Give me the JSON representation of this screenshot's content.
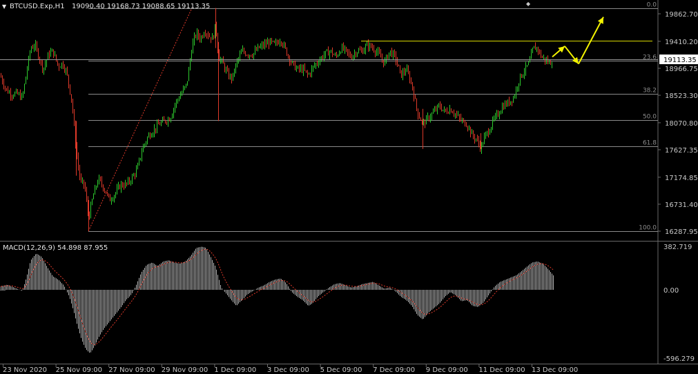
{
  "window": {
    "symbol_title": "BTCUSD.Exp,H1",
    "ohlc_text": "19090.40 19168.73 19088.65 19113.35",
    "dropdown_glyph": "▼"
  },
  "colors": {
    "background": "#000000",
    "bull": "#2ecc2e",
    "bear": "#e03a2a",
    "grid_line": "#8a8a8a",
    "resistance": "#d9d900",
    "arrow": "#f2f200",
    "macd_hist": "#b4b4b4",
    "signal": "#e03a2a",
    "text": "#c8c8c8"
  },
  "chart_data": [
    {
      "type": "candlestick",
      "title": "BTCUSD.Exp,H1",
      "price_axis_labels": [
        "19862.70",
        "19410.20",
        "18966.75",
        "18523.30",
        "18070.80",
        "17627.35",
        "17174.85",
        "16731.40",
        "16287.95"
      ],
      "current_price": "19113.35",
      "ylim": [
        16210,
        20080
      ],
      "x_labels": [
        "23 Nov 2020",
        "25 Nov 09:00",
        "27 Nov 09:00",
        "29 Nov 09:00",
        "1 Dec 09:00",
        "3 Dec 09:00",
        "5 Dec 09:00",
        "7 Dec 09:00",
        "9 Dec 09:00",
        "11 Dec 09:00",
        "13 Dec 09:00"
      ],
      "close_path": [
        [
          0,
          18850
        ],
        [
          8,
          18620
        ],
        [
          16,
          18540
        ],
        [
          24,
          18550
        ],
        [
          32,
          18480
        ],
        [
          38,
          18900
        ],
        [
          44,
          19300
        ],
        [
          50,
          19350
        ],
        [
          56,
          19150
        ],
        [
          62,
          18950
        ],
        [
          70,
          19200
        ],
        [
          76,
          19250
        ],
        [
          84,
          19000
        ],
        [
          90,
          19050
        ],
        [
          96,
          18900
        ],
        [
          104,
          18400
        ],
        [
          110,
          17600
        ],
        [
          116,
          17100
        ],
        [
          122,
          17050
        ],
        [
          128,
          16500
        ],
        [
          134,
          16850
        ],
        [
          142,
          17150
        ],
        [
          150,
          17000
        ],
        [
          158,
          16800
        ],
        [
          166,
          16900
        ],
        [
          174,
          17050
        ],
        [
          182,
          17050
        ],
        [
          190,
          17150
        ],
        [
          198,
          17300
        ],
        [
          206,
          17650
        ],
        [
          214,
          17850
        ],
        [
          222,
          17950
        ],
        [
          230,
          18050
        ],
        [
          238,
          18100
        ],
        [
          246,
          18150
        ],
        [
          254,
          18400
        ],
        [
          262,
          18550
        ],
        [
          270,
          18700
        ],
        [
          278,
          19350
        ],
        [
          284,
          19550
        ],
        [
          290,
          19450
        ],
        [
          296,
          19600
        ],
        [
          302,
          19500
        ],
        [
          308,
          19450
        ],
        [
          312,
          19700
        ],
        [
          316,
          19150
        ],
        [
          322,
          19050
        ],
        [
          330,
          18850
        ],
        [
          336,
          18800
        ],
        [
          342,
          19050
        ],
        [
          350,
          19250
        ],
        [
          358,
          19200
        ],
        [
          366,
          19200
        ],
        [
          374,
          19300
        ],
        [
          382,
          19350
        ],
        [
          390,
          19400
        ],
        [
          398,
          19350
        ],
        [
          406,
          19450
        ],
        [
          414,
          19250
        ],
        [
          422,
          19050
        ],
        [
          430,
          18950
        ],
        [
          438,
          18950
        ],
        [
          446,
          18850
        ],
        [
          454,
          19000
        ],
        [
          462,
          19100
        ],
        [
          470,
          19200
        ],
        [
          478,
          19250
        ],
        [
          486,
          19150
        ],
        [
          494,
          19300
        ],
        [
          500,
          19250
        ],
        [
          508,
          19150
        ],
        [
          516,
          19250
        ],
        [
          524,
          19250
        ],
        [
          532,
          19350
        ],
        [
          540,
          19300
        ],
        [
          548,
          19200
        ],
        [
          556,
          19050
        ],
        [
          564,
          19250
        ],
        [
          572,
          19150
        ],
        [
          580,
          18850
        ],
        [
          588,
          18950
        ],
        [
          596,
          18700
        ],
        [
          604,
          18250
        ],
        [
          612,
          18050
        ],
        [
          620,
          18150
        ],
        [
          628,
          18250
        ],
        [
          636,
          18350
        ],
        [
          644,
          18250
        ],
        [
          652,
          18300
        ],
        [
          660,
          18200
        ],
        [
          668,
          18100
        ],
        [
          676,
          18050
        ],
        [
          684,
          17850
        ],
        [
          690,
          17800
        ],
        [
          696,
          17650
        ],
        [
          702,
          17850
        ],
        [
          708,
          17950
        ],
        [
          714,
          18100
        ],
        [
          720,
          18200
        ],
        [
          728,
          18350
        ],
        [
          736,
          18400
        ],
        [
          744,
          18500
        ],
        [
          752,
          18800
        ],
        [
          760,
          18950
        ],
        [
          766,
          19050
        ],
        [
          772,
          19300
        ],
        [
          778,
          19300
        ],
        [
          784,
          19150
        ],
        [
          790,
          19100
        ],
        [
          796,
          19050
        ],
        [
          800,
          19110
        ]
      ],
      "fibonacci": {
        "levels": [
          {
            "label": "0.0",
            "price": 19958
          },
          {
            "label": "23.6",
            "price": 19090
          },
          {
            "label": "38.2",
            "price": 18550
          },
          {
            "label": "50.0",
            "price": 18118
          },
          {
            "label": "61.8",
            "price": 17685
          },
          {
            "label": "100.0",
            "price": 16287
          }
        ],
        "swing_from": {
          "bar_x": 128,
          "price": 16287
        },
        "swing_to": {
          "bar_x": 278,
          "price": 19958
        }
      },
      "resistance_line": {
        "price": 19420,
        "from_x": 523,
        "to_x": 945
      },
      "forecast_arrows": [
        {
          "from": [
            800,
            19155
          ],
          "to": [
            818,
            19330
          ]
        },
        {
          "from": [
            818,
            19330
          ],
          "to": [
            838,
            19040
          ]
        },
        {
          "from": [
            838,
            19040
          ],
          "to": [
            874,
            19810
          ]
        }
      ]
    },
    {
      "type": "histogram",
      "title": "MACD(12,26,9) 54.898 87.955",
      "axis_labels": [
        "382.719",
        "0.00",
        "-596.279"
      ],
      "ylim": [
        -596.279,
        382.719
      ],
      "macd_path": [
        [
          0,
          30
        ],
        [
          10,
          45
        ],
        [
          20,
          20
        ],
        [
          32,
          -10
        ],
        [
          38,
          110
        ],
        [
          44,
          260
        ],
        [
          52,
          320
        ],
        [
          60,
          290
        ],
        [
          68,
          200
        ],
        [
          76,
          120
        ],
        [
          84,
          90
        ],
        [
          92,
          40
        ],
        [
          100,
          -60
        ],
        [
          106,
          -180
        ],
        [
          112,
          -320
        ],
        [
          118,
          -440
        ],
        [
          124,
          -520
        ],
        [
          130,
          -555
        ],
        [
          136,
          -500
        ],
        [
          142,
          -420
        ],
        [
          150,
          -340
        ],
        [
          158,
          -280
        ],
        [
          166,
          -220
        ],
        [
          174,
          -160
        ],
        [
          182,
          -90
        ],
        [
          190,
          -40
        ],
        [
          196,
          30
        ],
        [
          204,
          150
        ],
        [
          212,
          220
        ],
        [
          220,
          240
        ],
        [
          228,
          210
        ],
        [
          236,
          250
        ],
        [
          244,
          260
        ],
        [
          252,
          240
        ],
        [
          260,
          230
        ],
        [
          268,
          250
        ],
        [
          276,
          300
        ],
        [
          284,
          370
        ],
        [
          292,
          380
        ],
        [
          298,
          370
        ],
        [
          304,
          300
        ],
        [
          312,
          200
        ],
        [
          320,
          20
        ],
        [
          328,
          -40
        ],
        [
          336,
          -100
        ],
        [
          342,
          -140
        ],
        [
          350,
          -90
        ],
        [
          358,
          -40
        ],
        [
          366,
          -10
        ],
        [
          374,
          20
        ],
        [
          382,
          40
        ],
        [
          390,
          70
        ],
        [
          398,
          90
        ],
        [
          406,
          100
        ],
        [
          414,
          60
        ],
        [
          422,
          -20
        ],
        [
          430,
          -60
        ],
        [
          438,
          -90
        ],
        [
          446,
          -140
        ],
        [
          452,
          -120
        ],
        [
          460,
          -60
        ],
        [
          468,
          -20
        ],
        [
          476,
          20
        ],
        [
          484,
          50
        ],
        [
          492,
          60
        ],
        [
          500,
          40
        ],
        [
          508,
          20
        ],
        [
          516,
          30
        ],
        [
          524,
          50
        ],
        [
          532,
          60
        ],
        [
          540,
          70
        ],
        [
          548,
          40
        ],
        [
          556,
          10
        ],
        [
          564,
          20
        ],
        [
          572,
          -10
        ],
        [
          580,
          -60
        ],
        [
          588,
          -90
        ],
        [
          596,
          -140
        ],
        [
          604,
          -220
        ],
        [
          612,
          -260
        ],
        [
          620,
          -200
        ],
        [
          628,
          -160
        ],
        [
          636,
          -120
        ],
        [
          644,
          -60
        ],
        [
          652,
          -20
        ],
        [
          660,
          -50
        ],
        [
          668,
          -100
        ],
        [
          676,
          -90
        ],
        [
          684,
          -140
        ],
        [
          692,
          -150
        ],
        [
          700,
          -110
        ],
        [
          708,
          -40
        ],
        [
          716,
          30
        ],
        [
          724,
          70
        ],
        [
          732,
          90
        ],
        [
          740,
          110
        ],
        [
          748,
          130
        ],
        [
          756,
          170
        ],
        [
          764,
          210
        ],
        [
          770,
          240
        ],
        [
          778,
          250
        ],
        [
          786,
          230
        ],
        [
          794,
          180
        ],
        [
          802,
          120
        ]
      ]
    }
  ]
}
